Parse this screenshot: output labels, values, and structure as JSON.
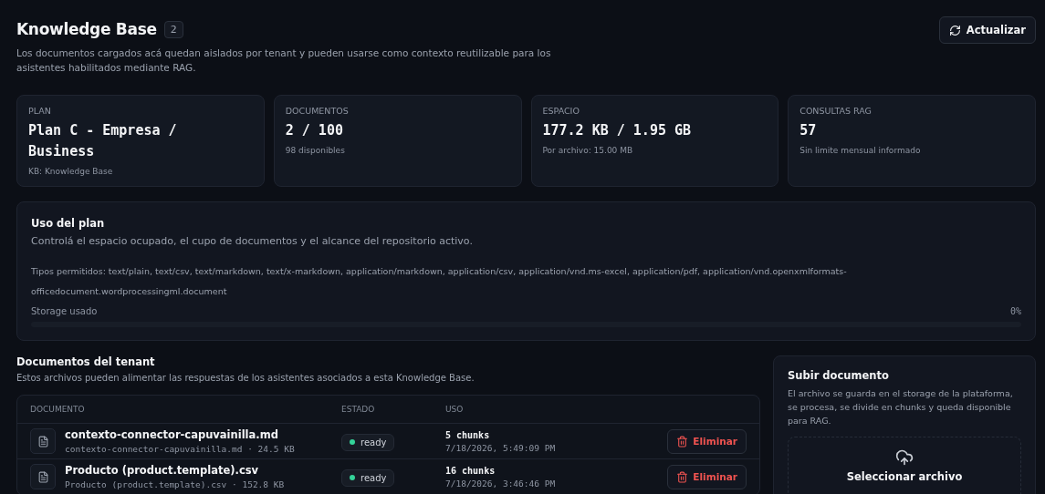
{
  "header": {
    "title": "Knowledge Base",
    "count": "2",
    "description": "Los documentos cargados acá quedan aislados por tenant y pueden usarse como contexto reutilizable para los asistentes habilitados mediante RAG.",
    "refresh_button": "Actualizar"
  },
  "stats": [
    {
      "label": "PLAN",
      "value": "Plan C - Empresa / Business",
      "note": "KB: Knowledge Base"
    },
    {
      "label": "DOCUMENTOS",
      "value": "2 / 100",
      "note": "98 disponibles"
    },
    {
      "label": "ESPACIO",
      "value": "177.2 KB / 1.95 GB",
      "note": "Por archivo: 15.00 MB"
    },
    {
      "label": "CONSULTAS RAG",
      "value": "57",
      "note": "Sin limite mensual informado"
    }
  ],
  "usage": {
    "title": "Uso del plan",
    "subtitle": "Controlá el espacio ocupado, el cupo de documentos y el alcance del repositorio activo.",
    "allowed_types": "Tipos permitidos: text/plain, text/csv, text/markdown, text/x-markdown, application/markdown, application/csv, application/vnd.ms-excel, application/pdf, application/vnd.openxmlformats-officedocument.wordprocessingml.document",
    "storage_label": "Storage usado",
    "storage_reading": "0%",
    "level": 0
  },
  "documents": {
    "title": "Documentos del tenant",
    "subtitle": "Estos archivos pueden alimentar las respuestas de los asistentes asociados a esta Knowledge Base.",
    "columns": [
      "DOCUMENTO",
      "ESTADO",
      "USO"
    ],
    "rows": [
      {
        "name": "contexto-connector-capuvainilla.md",
        "meta": "contexto-connector-capuvainilla.md · 24.5 KB",
        "status": "ready",
        "chunks": "5 chunks",
        "date": "7/18/2026, 5:49:09 PM",
        "action": "Eliminar"
      },
      {
        "name": "Producto (product.template).csv",
        "meta": "Producto (product.template).csv · 152.8 KB",
        "status": "ready",
        "chunks": "16 chunks",
        "date": "7/18/2026, 3:46:46 PM",
        "action": "Eliminar"
      }
    ]
  },
  "upload": {
    "title": "Subir documento",
    "description": "El archivo se guarda en el storage de la plataforma, se procesa, se divide en chunks y queda disponible para RAG.",
    "button": "Seleccionar archivo"
  }
}
